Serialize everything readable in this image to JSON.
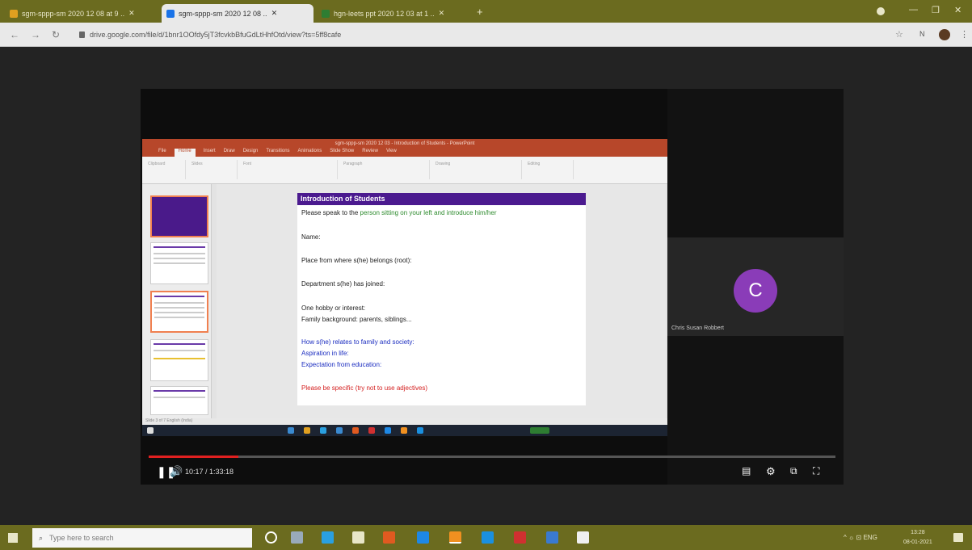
{
  "browser": {
    "tabs": [
      {
        "label": "sgm-sppp-sm 2020 12 08 at 9 ..",
        "color": "#e0a020"
      },
      {
        "label": "sgm-sppp-sm 2020 12 08 ..",
        "color": "#1a73e8"
      },
      {
        "label": "hgn-leets ppt 2020 12 03 at 1 ..",
        "color": "#2e7d32"
      }
    ],
    "new_tab": "+",
    "url": "drive.google.com/file/d/1bnr1OOfdy5jT3fcvkbBfuGdLtHhfOtd/view?ts=5ff8cafe",
    "window_controls": [
      "—",
      "❐",
      "✕"
    ]
  },
  "powerpoint": {
    "title_bar": "sgm-sppp-sm 2020 12 03 - Introduction of Students - PowerPoint",
    "ribbon_tabs": [
      "File",
      "Home",
      "Insert",
      "Draw",
      "Design",
      "Transitions",
      "Animations",
      "Slide Show",
      "Review",
      "View"
    ],
    "ribbon_groups": [
      "Clipboard",
      "Slides",
      "Font",
      "Paragraph",
      "Drawing",
      "Editing"
    ],
    "status": "Slide 3 of 7   English (India)",
    "slide": {
      "title": "Introduction of Students",
      "lines": [
        {
          "text": "Please speak to the ",
          "color": "blk",
          "more": "person sitting on your left and introduce him/her"
        },
        {
          "text": "Name:",
          "color": "blk"
        },
        {
          "text": "Place from where s(he) belongs (root):",
          "color": "blk"
        },
        {
          "text": "Department s(he) has joined:",
          "color": "blk"
        },
        {
          "text": "One hobby or interest:",
          "color": "blk"
        },
        {
          "text": "Family background: parents, siblings...",
          "color": "blk"
        },
        {
          "text": "How s(he) relates to family and society:",
          "color": "blu"
        },
        {
          "text": "Aspiration in life:",
          "color": "blu"
        },
        {
          "text": "Expectation from education:",
          "color": "blu"
        },
        {
          "text": "Please be specific (try not to use adjectives)",
          "color": "red"
        }
      ]
    }
  },
  "participant": {
    "initial": "C",
    "name": "Chris Susan Robbert",
    "color": "#8a3cb8"
  },
  "player": {
    "time": "10:17 / 1:33:18",
    "progress": 0.13
  },
  "taskbar": {
    "search_placeholder": "Type here to search",
    "tray": "^ ☼ ⊡ ENG",
    "clock_time": "13:28",
    "clock_date": "08-01-2021",
    "app_colors": [
      "#ffffff",
      "#9ab",
      "#2aa0e0",
      "#e8e6c8",
      "#e05a20",
      "#1e88e5",
      "#f09020",
      "#1a90e0",
      "#d03030",
      "#3a7ad0",
      "#f0f0f0"
    ]
  }
}
